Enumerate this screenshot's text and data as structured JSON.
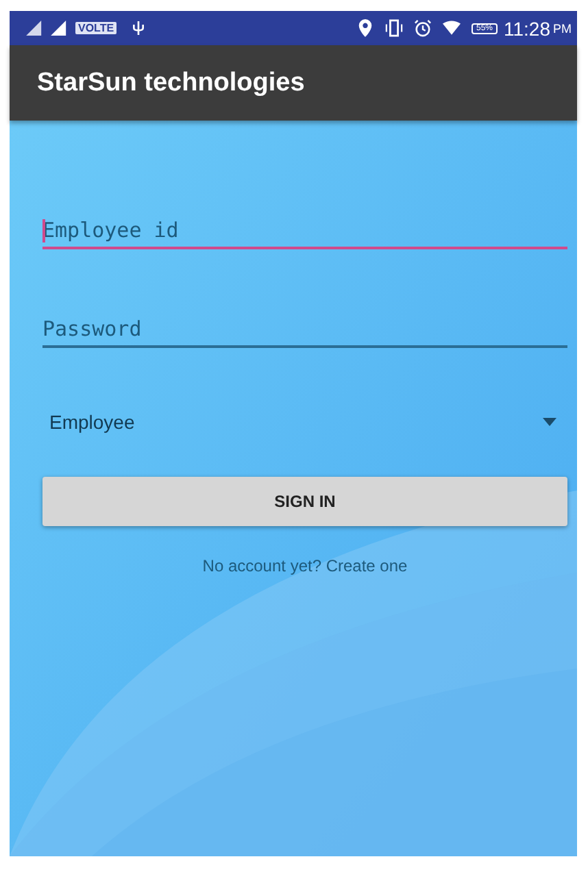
{
  "status_bar": {
    "network": "VOLTE",
    "battery": "55%",
    "time": "11:28",
    "meridiem": "PM"
  },
  "app_bar": {
    "title": "StarSun technologies"
  },
  "fields": [
    {
      "placeholder": "Employee id",
      "focused": true
    },
    {
      "placeholder": "Password",
      "focused": false
    }
  ],
  "role_dropdown": {
    "value": "Employee"
  },
  "sign_in_button": "SIGN IN",
  "create_account_link": "No account yet? Create one"
}
